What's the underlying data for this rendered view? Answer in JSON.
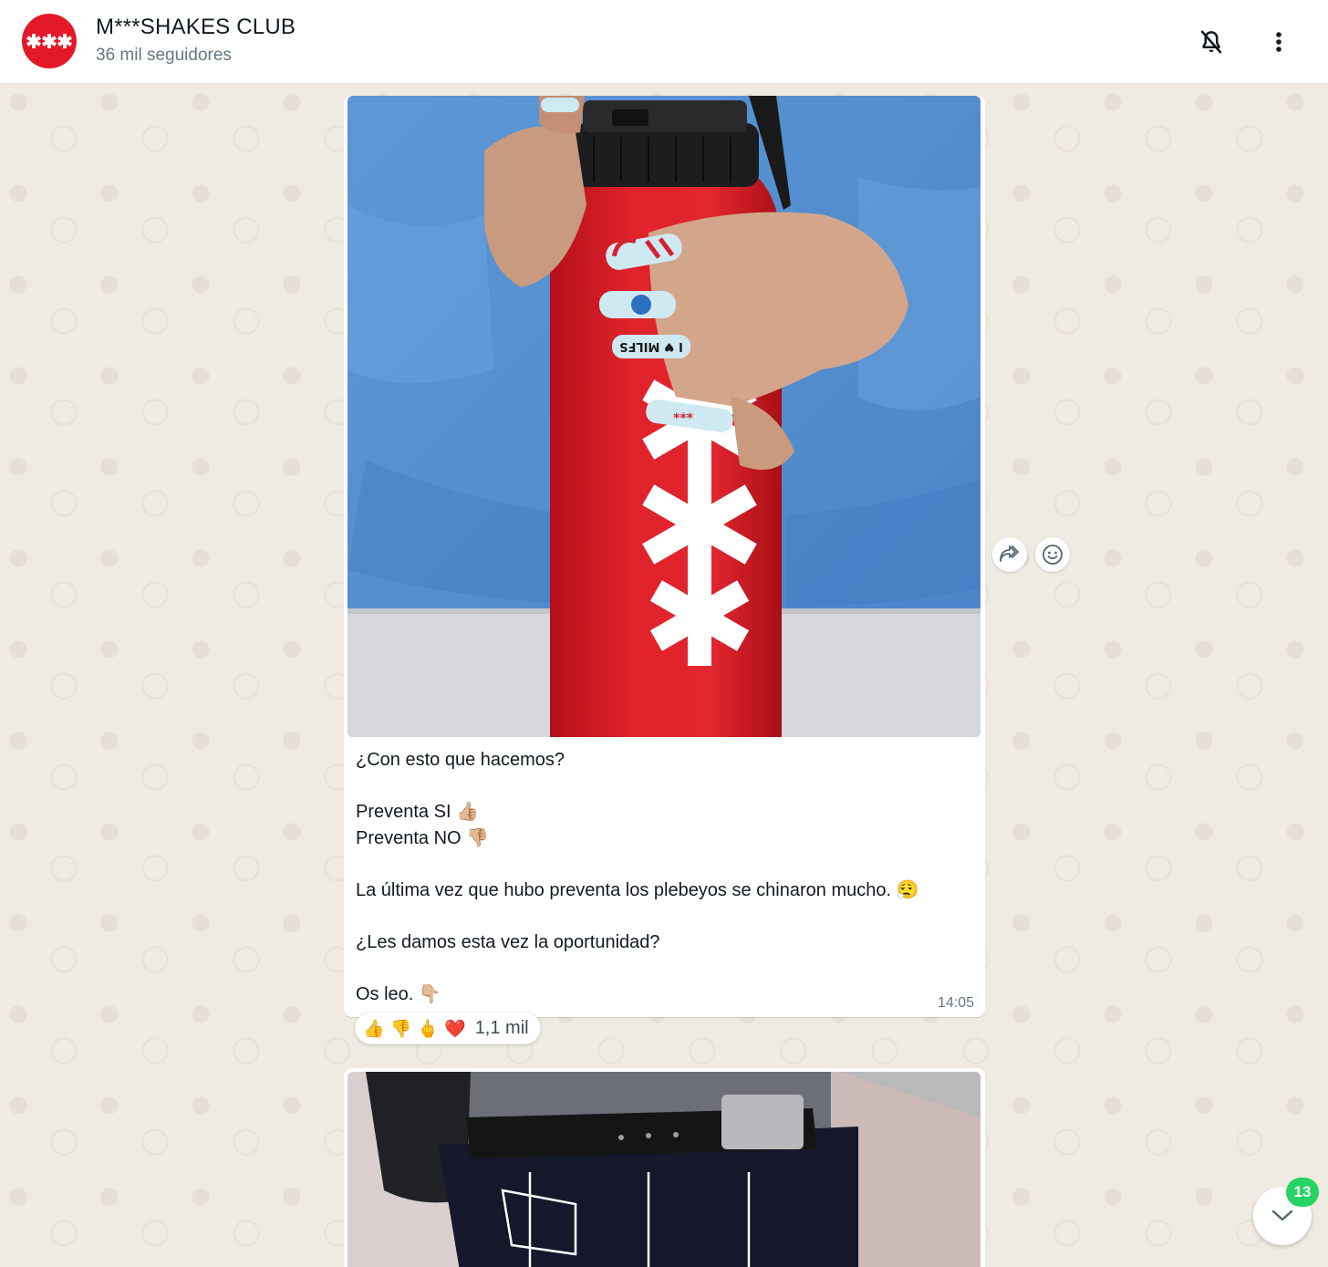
{
  "header": {
    "channel_name": "M***SHAKES CLUB",
    "followers": "36 mil seguidores",
    "avatar_logo_text": "***"
  },
  "message": {
    "caption_lines": [
      "¿Con esto que hacemos?",
      "",
      "Preventa SI 👍🏼",
      "Preventa NO 👎🏼",
      "",
      "La última vez que hubo preventa los plebeyos se chinaron mucho. 😮‍💨",
      "",
      "¿Les damos esta vez la oportunidad?",
      "",
      "Os leo. 👇🏼"
    ],
    "time": "14:05",
    "reactions": {
      "emojis": [
        "👍",
        "👎",
        "🖕",
        "❤️"
      ],
      "count": "1,1 mil"
    },
    "photo_nail_text": "I ♥ MILFS"
  },
  "scroll": {
    "unread_count": "13"
  },
  "colors": {
    "brand_red": "#e3192a",
    "badge_green": "#25d366",
    "chat_bg": "#efeae2"
  },
  "icons": [
    "mute-bell-icon",
    "more-vertical-icon",
    "forward-icon",
    "emoji-reaction-icon",
    "chevron-down-icon"
  ]
}
